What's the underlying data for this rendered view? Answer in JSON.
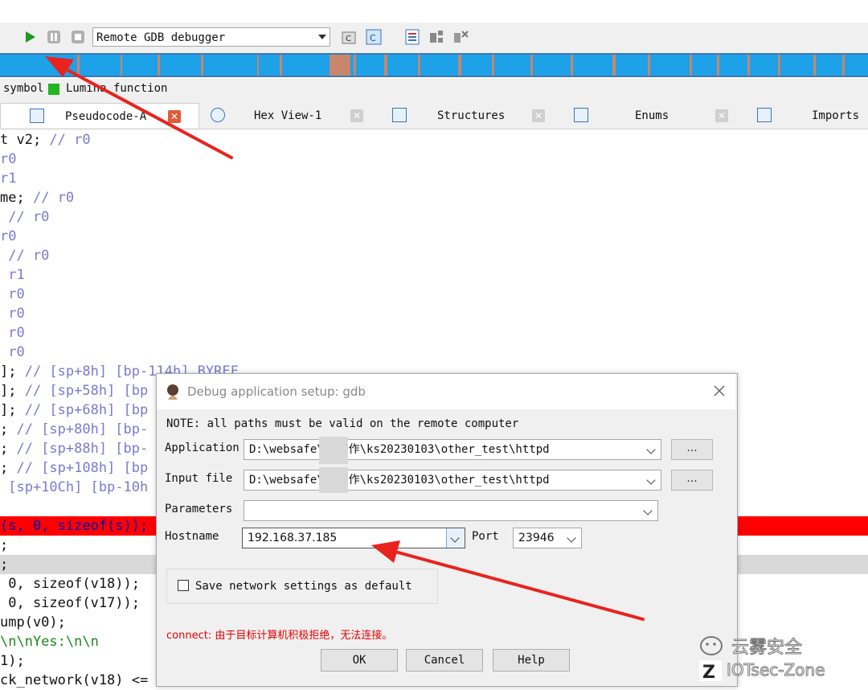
{
  "toolbar": {
    "debugger_select": "Remote GDB debugger"
  },
  "legend": {
    "symbol_label": "symbol",
    "lumina_label": "Lumina function"
  },
  "tabs": [
    {
      "label": "Pseudocode-A"
    },
    {
      "label": "Hex View-1"
    },
    {
      "label": "Structures"
    },
    {
      "label": "Enums"
    },
    {
      "label": "Imports"
    }
  ],
  "code": {
    "l0a": "t v2; ",
    "l0b": "// r0",
    "l1": "r0",
    "l2": "r1",
    "l3a": "me; ",
    "l3b": "// r0",
    "l4": " // r0",
    "l5": "r0",
    "l6": " // r0",
    "l7": " r1",
    "l8": " r0",
    "l9": " r0",
    "l10": " r0",
    "l11": " r0",
    "l12a": "]; ",
    "l12b": "// [sp+8h] [bp-114h] BYREF",
    "l13a": "]; ",
    "l13b": "// [sp+58h] [bp",
    "l14a": "]; ",
    "l14b": "// [sp+68h] [bp",
    "l15a": "; ",
    "l15b": "// [sp+80h] [bp-",
    "l16a": "; ",
    "l16b": "// [sp+88h] [bp-",
    "l17a": "; ",
    "l17b": "// [sp+108h] [bp",
    "l18": " [sp+10Ch] [bp-10h",
    "l19": "(s, 0, sizeof(s));",
    "l20": ";",
    "l21": ";",
    "l22": " 0, sizeof(v18));",
    "l23": " 0, sizeof(v17));",
    "l24": "ump(v0);",
    "l25": "\\n\\nYes:\\n\\n",
    "l26": "1);",
    "l27": "ck_network(v18) <= 0 )"
  },
  "dialog": {
    "title": "Debug application setup: gdb",
    "note": "NOTE: all paths must be valid on the remote computer",
    "application_label": "Application",
    "application_value": "D:\\websafe\\ \\工作\\ks20230103\\other_test\\httpd",
    "input_file_label": "Input file",
    "input_file_value": "D:\\websafe\\ \\工作\\ks20230103\\other_test\\httpd",
    "parameters_label": "Parameters",
    "parameters_value": "",
    "hostname_label": "Hostname",
    "hostname_value": "192.168.37.185",
    "port_label": "Port",
    "port_value": "23946",
    "browse_label": "...",
    "save_default_label": "Save network settings as default",
    "save_default_checked": false,
    "error_text": "connect: 由于目标计算机积极拒绝，无法连接。",
    "ok_label": "OK",
    "cancel_label": "Cancel",
    "help_label": "Help"
  },
  "watermark": {
    "brand_cn": "云雾安全",
    "brand_en": "IOTsec-Zone"
  },
  "colors": {
    "nav_blue": "#1da1e8",
    "highlight_red": "#ff0000",
    "arrow_red": "#e8231e",
    "code_blue": "#0000c8"
  }
}
